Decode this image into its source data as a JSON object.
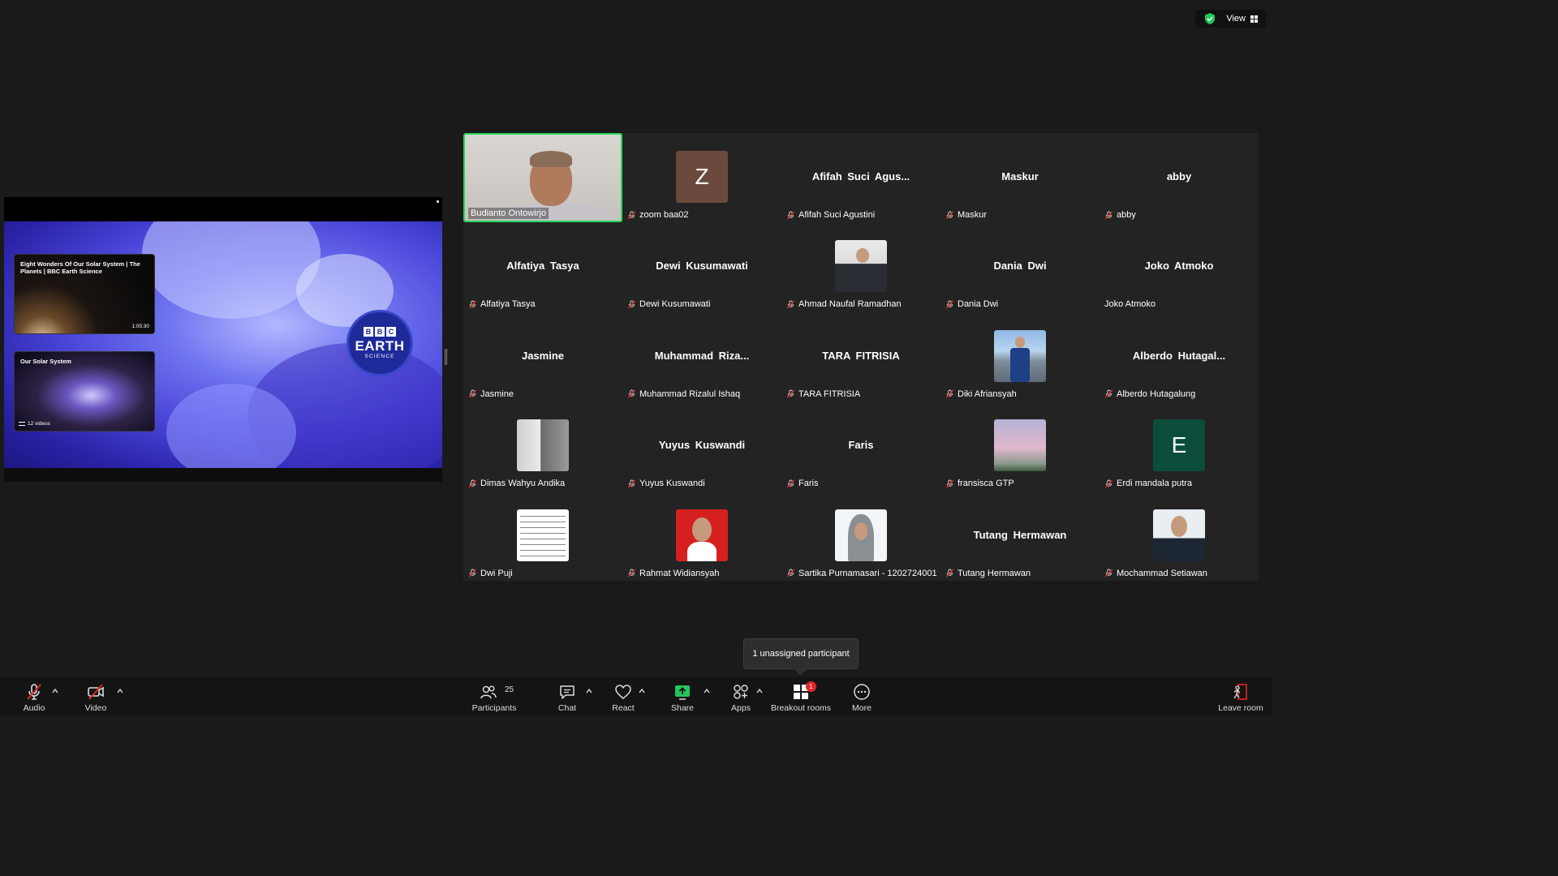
{
  "window": {
    "view_label": "View",
    "encryption_icon": "shield-check-icon"
  },
  "share": {
    "videos": [
      {
        "title": "Eight Wonders Of Our Solar System | The Planets | BBC Earth Science",
        "duration": "1:05:30"
      },
      {
        "title": "Our Solar System",
        "count": "12 videos"
      }
    ],
    "logo": {
      "boxes": [
        "B",
        "B",
        "C"
      ],
      "main": "EARTH",
      "sub": "SCIENCE"
    }
  },
  "participants": [
    {
      "display": "Budianto Ontowirjo",
      "avatar_type": "camera",
      "muted": false,
      "active": true
    },
    {
      "display": "zoom baa02",
      "avatar_type": "letter",
      "letter": "Z",
      "color": "#6b4a3d",
      "muted": true
    },
    {
      "display": "Afifah Suci Agustini",
      "big_name": "Afifah  Suci  Agus...",
      "avatar_type": "name",
      "muted": true
    },
    {
      "display": "Maskur",
      "big_name": "Maskur",
      "avatar_type": "name",
      "muted": true
    },
    {
      "display": "abby",
      "big_name": "abby",
      "avatar_type": "name",
      "muted": true
    },
    {
      "display": "Alfatiya Tasya",
      "big_name": "Alfatiya Tasya",
      "avatar_type": "name",
      "muted": true
    },
    {
      "display": "Dewi Kusumawati",
      "big_name": "Dewi Kusumawati",
      "avatar_type": "name",
      "muted": true
    },
    {
      "display": "Ahmad Naufal Ramadhan",
      "avatar_type": "photo",
      "photo": "photo-man",
      "muted": true
    },
    {
      "display": "Dania Dwi",
      "big_name": "Dania Dwi",
      "avatar_type": "name",
      "muted": true
    },
    {
      "display": "Joko Atmoko",
      "big_name": "Joko Atmoko",
      "avatar_type": "name",
      "muted": false
    },
    {
      "display": "Jasmine",
      "big_name": "Jasmine",
      "avatar_type": "name",
      "muted": true
    },
    {
      "display": "Muhammad Rizalul Ishaq",
      "big_name": "Muhammad  Riza...",
      "avatar_type": "name",
      "muted": true
    },
    {
      "display": "TARA FITRISIA",
      "big_name": "TARA FITRISIA",
      "avatar_type": "name",
      "muted": true
    },
    {
      "display": "Diki Afriansyah",
      "avatar_type": "photo",
      "photo": "photo-outdoor",
      "muted": true
    },
    {
      "display": "Alberdo Hutagalung",
      "big_name": "Alberdo  Hutagal...",
      "avatar_type": "name",
      "muted": true
    },
    {
      "display": "Dimas Wahyu Andika",
      "avatar_type": "photo",
      "photo": "photo-grey",
      "muted": true
    },
    {
      "display": "Yuyus Kuswandi",
      "big_name": "Yuyus Kuswandi",
      "avatar_type": "name",
      "muted": true
    },
    {
      "display": "Faris",
      "big_name": "Faris",
      "avatar_type": "name",
      "muted": true
    },
    {
      "display": "fransisca GTP",
      "avatar_type": "photo",
      "photo": "photo-sky",
      "muted": true
    },
    {
      "display": "Erdi mandala putra",
      "avatar_type": "letter",
      "letter": "E",
      "color": "#0b4d3a",
      "muted": true
    },
    {
      "display": "Dwi Puji",
      "avatar_type": "photo",
      "photo": "photo-doc",
      "muted": true
    },
    {
      "display": "Rahmat Widiansyah",
      "avatar_type": "photo",
      "photo": "photo-red",
      "muted": true
    },
    {
      "display": "Sartika Purnamasari - 1202724001",
      "avatar_type": "photo",
      "photo": "photo-hijab",
      "muted": true
    },
    {
      "display": "Tutang Hermawan",
      "big_name": "Tutang Hermawan",
      "avatar_type": "name",
      "muted": true
    },
    {
      "display": "Mochammad Setiawan",
      "avatar_type": "photo",
      "photo": "photo-shirt",
      "muted": true
    }
  ],
  "tooltip": {
    "text": "1 unassigned participant"
  },
  "toolbar": {
    "audio": {
      "label": "Audio",
      "icon": "mic-muted-icon"
    },
    "video": {
      "label": "Video",
      "icon": "camera-off-icon"
    },
    "participants": {
      "label": "Participants",
      "count": "25",
      "icon": "participants-icon"
    },
    "chat": {
      "label": "Chat",
      "icon": "chat-icon"
    },
    "react": {
      "label": "React",
      "icon": "heart-icon"
    },
    "share": {
      "label": "Share",
      "icon": "share-screen-icon",
      "color": "#22c55e"
    },
    "apps": {
      "label": "Apps",
      "icon": "apps-icon"
    },
    "breakout": {
      "label": "Breakout rooms",
      "badge": "1",
      "icon": "breakout-rooms-icon"
    },
    "more": {
      "label": "More",
      "icon": "more-icon"
    },
    "leave": {
      "label": "Leave room",
      "icon": "leave-room-icon",
      "color": "#e02828"
    }
  }
}
